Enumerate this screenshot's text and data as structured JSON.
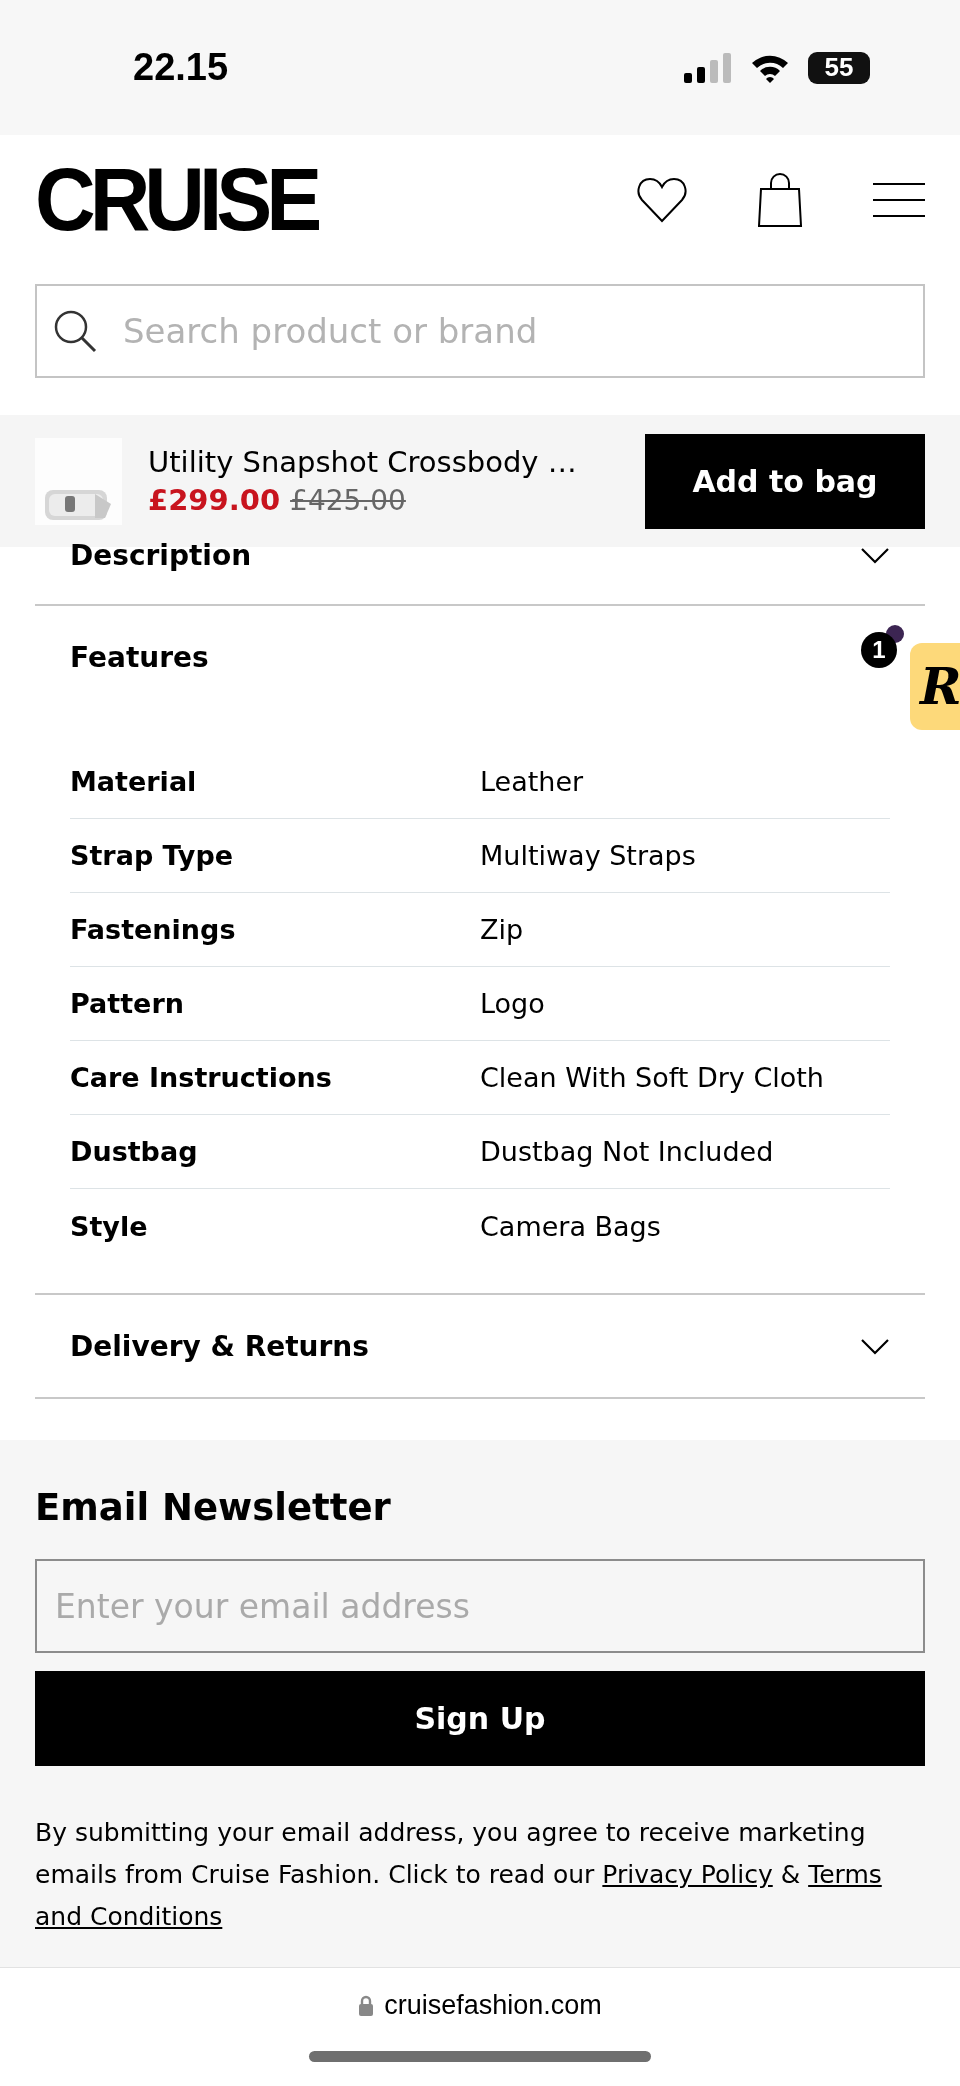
{
  "status_bar": {
    "time": "22.15",
    "battery": "55"
  },
  "header": {
    "logo": "CRUISE"
  },
  "search": {
    "placeholder": "Search product or brand"
  },
  "sticky_product": {
    "title": "Utility Snapshot Crossbody …",
    "price": "£299.00",
    "original_price": "£425.00",
    "button": "Add to bag"
  },
  "accordions": [
    {
      "title": "Description",
      "expanded": false
    },
    {
      "title": "Features",
      "expanded": true,
      "specs": [
        {
          "label": "Material",
          "value": "Leather"
        },
        {
          "label": "Strap Type",
          "value": "Multiway Straps"
        },
        {
          "label": "Fastenings",
          "value": "Zip"
        },
        {
          "label": "Pattern",
          "value": "Logo"
        },
        {
          "label": "Care Instructions",
          "value": "Clean With Soft Dry Cloth"
        },
        {
          "label": "Dustbag",
          "value": "Dustbag Not Included"
        },
        {
          "label": "Style",
          "value": "Camera Bags"
        }
      ]
    },
    {
      "title": "Delivery & Returns",
      "expanded": false
    }
  ],
  "review_widget": {
    "logo": "R",
    "badge": "1"
  },
  "newsletter": {
    "title": "Email Newsletter",
    "placeholder": "Enter your email address",
    "button": "Sign Up",
    "disclaimer": [
      {
        "kind": "text",
        "text": "By submitting your email address, you agree to receive marketing emails from Cruise Fashion. Click to read our "
      },
      {
        "kind": "link",
        "text": "Privacy Policy"
      },
      {
        "kind": "text",
        "text": " & "
      },
      {
        "kind": "link",
        "text": "Terms"
      },
      {
        "kind": "link",
        "text": "and Conditions"
      }
    ]
  },
  "browser": {
    "url": "cruisefashion.com"
  }
}
